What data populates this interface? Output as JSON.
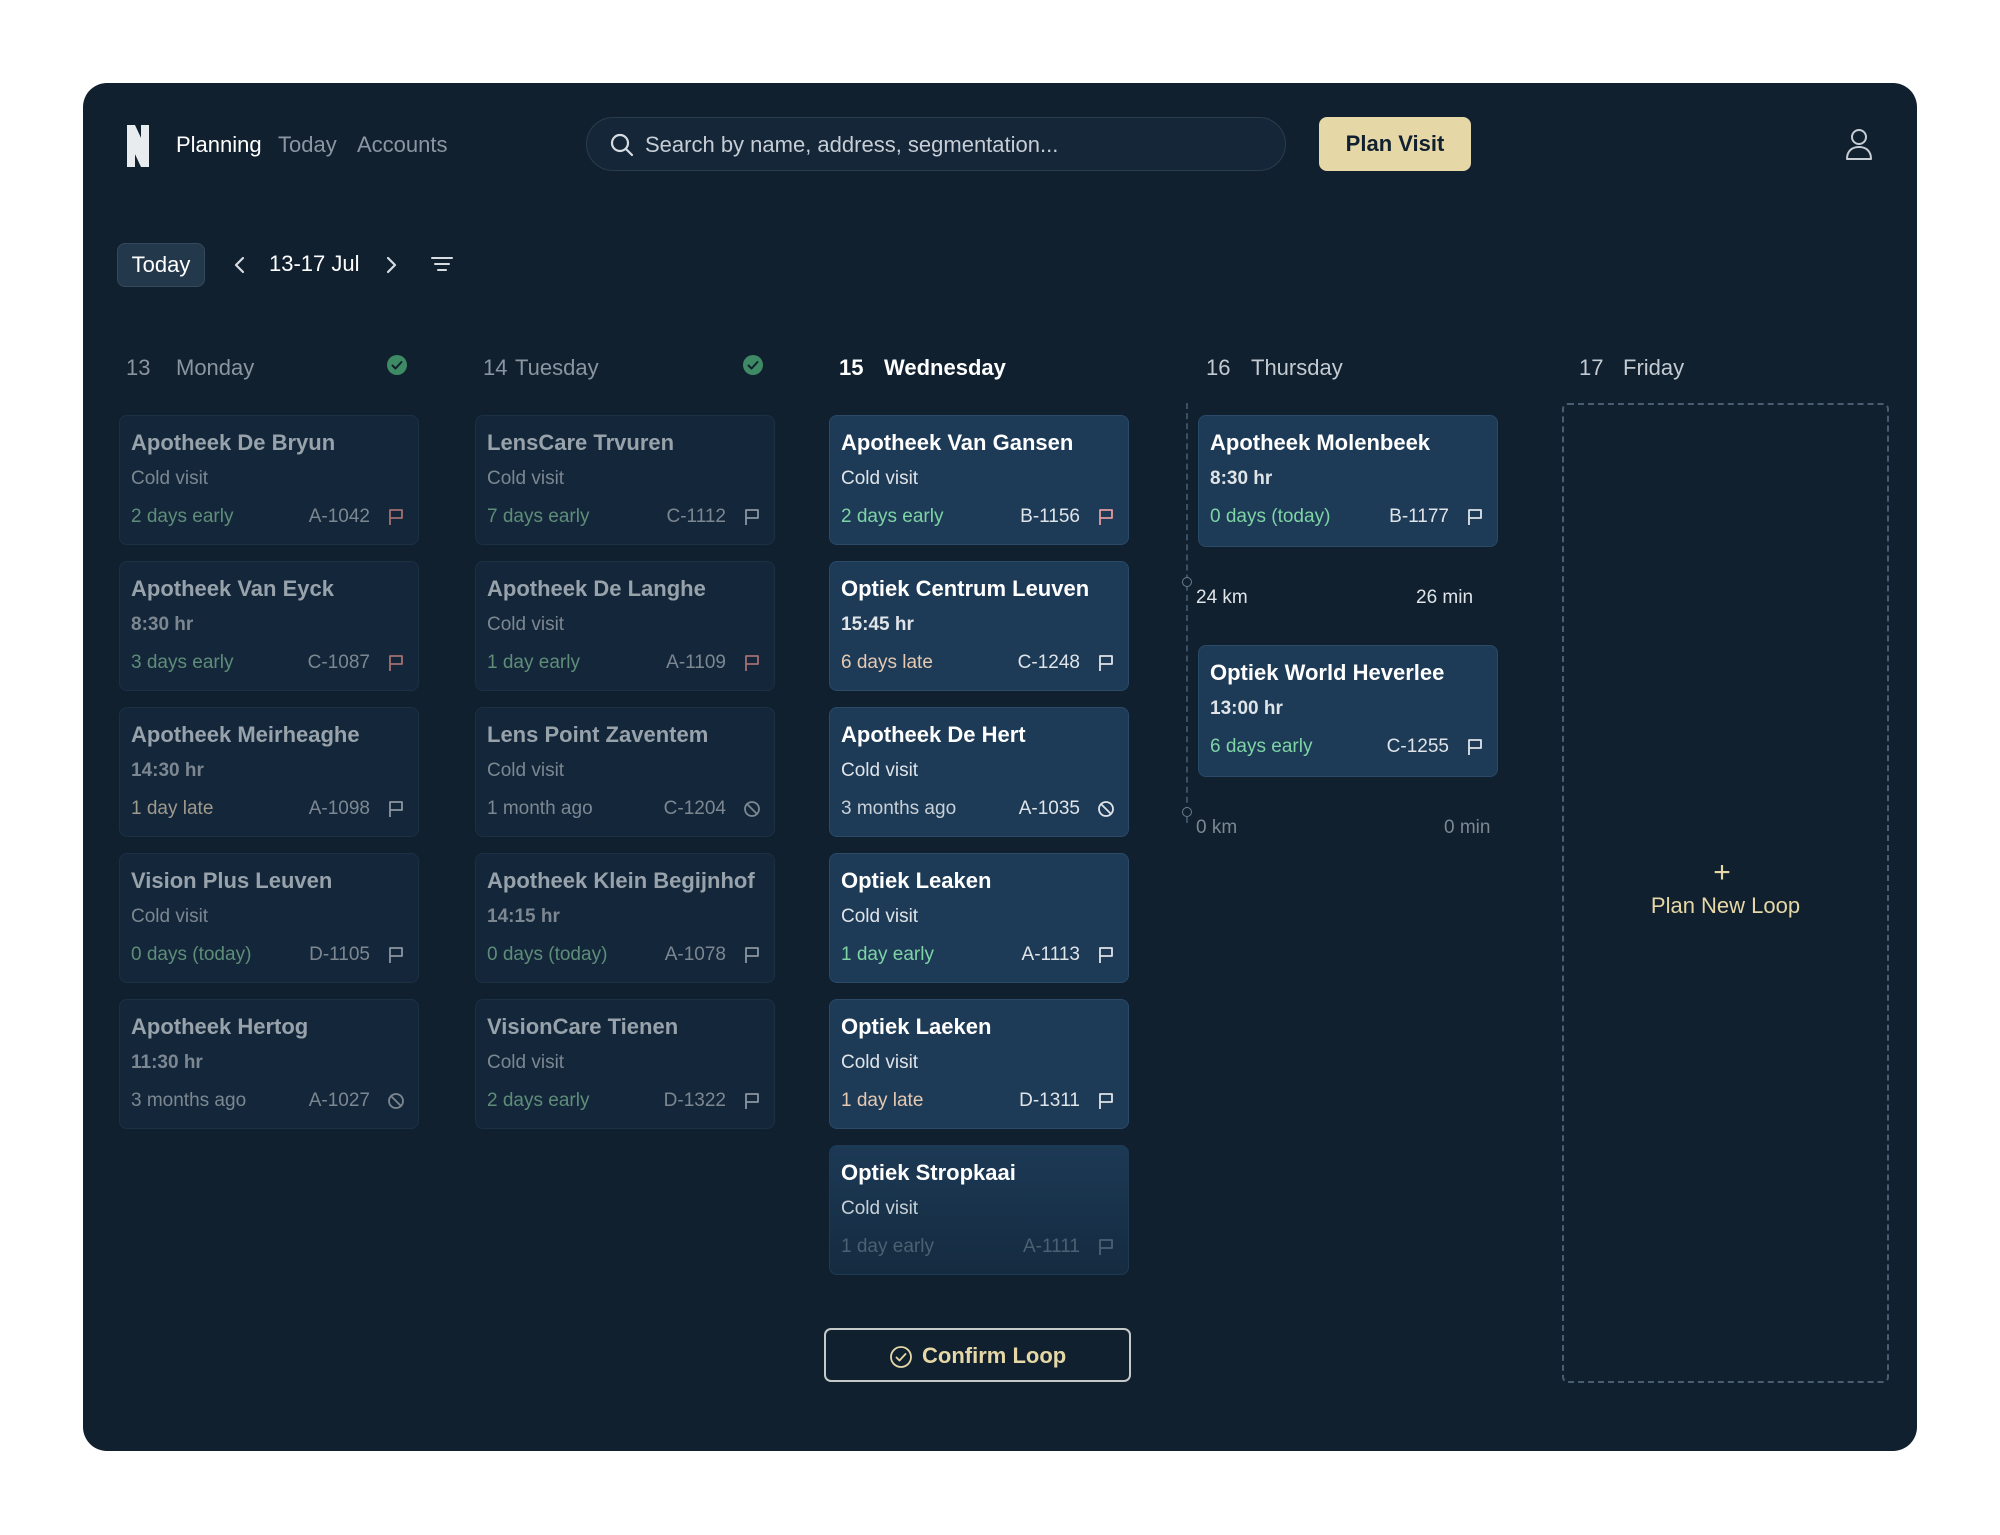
{
  "nav": {
    "items": [
      {
        "label": "Planning"
      },
      {
        "label": "Today"
      },
      {
        "label": "Accounts"
      }
    ]
  },
  "search": {
    "placeholder": "Search by name, address, segmentation..."
  },
  "plan_visit_label": "Plan Visit",
  "date_nav": {
    "today_label": "Today",
    "range": "13-17 Jul"
  },
  "days": [
    {
      "num": "13",
      "name": "Monday",
      "cards": [
        {
          "title": "Apotheek De Bryun",
          "sub": "Cold visit",
          "status": "2 days early",
          "code": "A-1042",
          "icon": "flag-icon"
        },
        {
          "title": "Apotheek Van Eyck",
          "sub": "8:30 hr",
          "status": "3 days early",
          "code": "C-1087",
          "icon": "flag-icon"
        },
        {
          "title": "Apotheek Meirheaghe",
          "sub": "14:30 hr",
          "status": "1 day late",
          "code": "A-1098",
          "icon": "flag-icon"
        },
        {
          "title": "Vision Plus Leuven",
          "sub": "Cold visit",
          "status": "0 days (today)",
          "code": "D-1105",
          "icon": "flag-icon"
        },
        {
          "title": "Apotheek Hertog",
          "sub": "11:30 hr",
          "status": "3 months ago",
          "code": "A-1027",
          "icon": "blocked-icon"
        }
      ]
    },
    {
      "num": "14",
      "name": "Tuesday",
      "cards": [
        {
          "title": "LensCare Trvuren",
          "sub": "Cold visit",
          "status": "7 days early",
          "code": "C-1112",
          "icon": "flag-icon"
        },
        {
          "title": "Apotheek De Langhe",
          "sub": "Cold visit",
          "status": "1 day early",
          "code": "A-1109",
          "icon": "flag-icon"
        },
        {
          "title": "Lens Point Zaventem",
          "sub": "Cold visit",
          "status": "1 month ago",
          "code": "C-1204",
          "icon": "blocked-icon"
        },
        {
          "title": "Apotheek Klein Begijnhof",
          "sub": "14:15 hr",
          "status": "0 days (today)",
          "code": "A-1078",
          "icon": "flag-icon"
        },
        {
          "title": "VisionCare Tienen",
          "sub": "Cold visit",
          "status": "2 days early",
          "code": "D-1322",
          "icon": "flag-icon"
        }
      ]
    },
    {
      "num": "15",
      "name": "Wednesday",
      "cards": [
        {
          "title": "Apotheek Van Gansen",
          "sub": "Cold visit",
          "status": "2 days early",
          "code": "B-1156",
          "icon": "flag-icon"
        },
        {
          "title": "Optiek Centrum Leuven",
          "sub": "15:45 hr",
          "status": "6 days late",
          "code": "C-1248",
          "icon": "flag-icon"
        },
        {
          "title": "Apotheek De Hert",
          "sub": "Cold visit",
          "status": "3 months ago",
          "code": "A-1035",
          "icon": "blocked-icon"
        },
        {
          "title": "Optiek Leaken",
          "sub": "Cold visit",
          "status": "1 day early",
          "code": "A-1113",
          "icon": "flag-icon"
        },
        {
          "title": "Optiek Laeken",
          "sub": "Cold visit",
          "status": "1 day late",
          "code": "D-1311",
          "icon": "flag-icon"
        },
        {
          "title": "Optiek Stropkaai",
          "sub": "Cold visit",
          "status": "1 day early",
          "code": "A-1111",
          "icon": "flag-icon"
        }
      ]
    },
    {
      "num": "16",
      "name": "Thursday",
      "cards": [
        {
          "title": "Apotheek Molenbeek",
          "sub": "8:30 hr",
          "status": "0 days (today)",
          "code": "B-1177",
          "icon": "flag-icon"
        },
        {
          "title": "Optiek World Heverlee",
          "sub": "13:00 hr",
          "status": "6 days early",
          "code": "C-1255",
          "icon": "flag-icon"
        }
      ],
      "legs": [
        {
          "distance": "24 km",
          "duration": "26 min"
        },
        {
          "distance": "0 km",
          "duration": "0 min"
        }
      ]
    },
    {
      "num": "17",
      "name": "Friday",
      "plan_new_loop_label": "Plan New Loop"
    }
  ],
  "confirm_loop_label": "Confirm Loop",
  "colors": {
    "background": "#10202f",
    "accent": "#e6d7a7",
    "early": "#7ed4a5",
    "late": "#e6c9b1",
    "done": "#3d8a64"
  }
}
